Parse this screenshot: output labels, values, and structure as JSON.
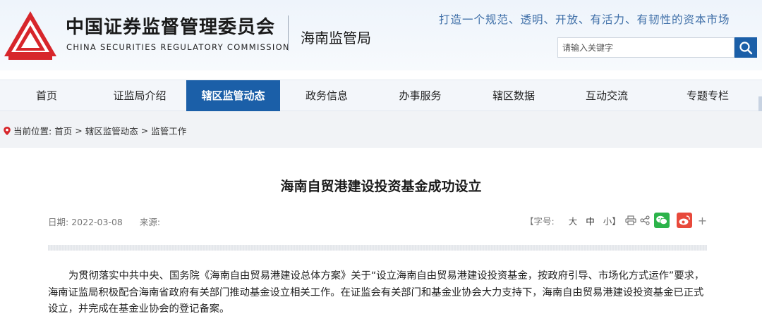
{
  "header": {
    "org_name_cn": "中国证券监督管理委员会",
    "org_name_en": "CHINA SECURITIES REGULATORY COMMISSION",
    "bureau_name": "海南监管局",
    "slogan": "打造一个规范、透明、开放、有活力、有韧性的资本市场",
    "search_placeholder": "请输入关键字",
    "logo_icon": "csrc-logo-icon",
    "search_icon": "search-icon"
  },
  "nav": {
    "items": [
      "首页",
      "证监局介绍",
      "辖区监管动态",
      "政务信息",
      "办事服务",
      "辖区数据",
      "互动交流",
      "专题专栏"
    ],
    "active_index": 2
  },
  "breadcrumb": {
    "prefix": "当前位置:",
    "items": [
      "首页",
      "辖区监管动态",
      "监管工作"
    ],
    "separator": ">",
    "icon": "location-pin-icon"
  },
  "article": {
    "title": "海南自贸港建设投资基金成功设立",
    "date_label": "日期:",
    "date": "2022-03-08",
    "source_label": "来源:",
    "font_size_label": "【字号:",
    "font_sizes": [
      "大",
      "中",
      "小】"
    ],
    "share_icons": [
      "print-icon",
      "share-icon",
      "wechat-icon",
      "weibo-icon",
      "plus-icon"
    ],
    "plus_symbol": "+",
    "body": "为贯彻落实中共中央、国务院《海南自由贸易港建设总体方案》关于“设立海南自由贸易港建设投资基金，按政府引导、市场化方式运作”要求，海南证监局积极配合海南省政府有关部门推动基金设立相关工作。在证监会有关部门和基金业协会大力支持下，海南自由贸易港建设投资基金已正式设立，并完成在基金业协会的登记备案。"
  },
  "colors": {
    "brand_red": "#d7262b",
    "nav_active": "#1b5fa8",
    "wechat": "#2cb34a",
    "weibo": "#e8493b",
    "slogan": "#3f6fa8"
  }
}
